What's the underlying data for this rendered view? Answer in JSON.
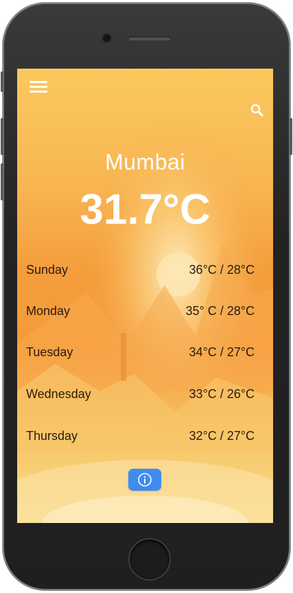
{
  "weather": {
    "city": "Mumbai",
    "current_temp": "31.7°C"
  },
  "forecast": [
    {
      "day": "Sunday",
      "range": "36°C / 28°C"
    },
    {
      "day": "Monday",
      "range": "35° C / 28°C"
    },
    {
      "day": "Tuesday",
      "range": "34°C / 27°C"
    },
    {
      "day": "Wednesday",
      "range": "33°C / 26°C"
    },
    {
      "day": "Thursday",
      "range": "32°C / 27°C"
    }
  ],
  "icons": {
    "menu": "hamburger-menu-icon",
    "search": "search-icon",
    "info": "info-icon"
  },
  "colors": {
    "accent": "#3f8cf0",
    "text": "#2a1a0e",
    "sky_top": "#fbc95e",
    "sky_mid": "#f49d3c"
  }
}
